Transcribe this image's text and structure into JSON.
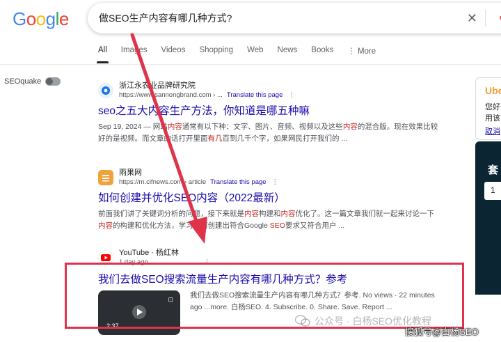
{
  "logo": {
    "letters": [
      "G",
      "o",
      "o",
      "g",
      "l",
      "e"
    ]
  },
  "search": {
    "query": "做SEO生产内容有哪几种方式?",
    "clear_icon": "close-icon",
    "mic_icon": "mic-icon"
  },
  "tabs": [
    "All",
    "Images",
    "Videos",
    "Shopping",
    "Web",
    "News",
    "Books",
    "⋮ More"
  ],
  "sidebar": {
    "seoquake_label": "SEOquake"
  },
  "results": [
    {
      "site_name": "浙江永",
      "site_name_tail": "农业品牌研究院",
      "url": "https://www.sannongbrand.com › ...",
      "translate": "Translate this page",
      "title": "seo之五大内容生产方法，你知道是哪五种嘛",
      "snippet_1_a": "Sep 19, 2024 — 网站",
      "snippet_1_hl": "内容",
      "snippet_1_b": "通常有以下种：文字、图片、音频、视频以及这些",
      "snippet_1_hl2": "内容",
      "snippet_1_c": "的混合版。现在效果比较",
      "snippet_2_a": "好的是视频。而文章的话打开里面",
      "snippet_2_hl": "有几",
      "snippet_2_b": "百到几千个字，如果网民打开我们的 ..."
    },
    {
      "site_name": "雨果网",
      "url": "https://m.cifnews.com › article",
      "translate": "Translate this page",
      "title": "如何创建并优化SEO内容（2022最新）",
      "snippet_1_a": "前面我们讲了关键词分析的问题，接下来就是",
      "snippet_1_hl": "内容",
      "snippet_1_b": "构建和",
      "snippet_1_hl2": "内容",
      "snippet_1_c": "优化了。这一篇文章我们就一起来讨论一下",
      "snippet_2_hl": "内容",
      "snippet_2_a": "的构建和优化方法，学习如何创建出符合Google ",
      "snippet_2_hl2": "SEO",
      "snippet_2_b": "要求又符合用户 ..."
    },
    {
      "site_name": "YouTube · 杨红林",
      "url": "1 day ago",
      "title": "我们去做SEO搜索流量生产内容有哪几种方式？参考",
      "snippet_1": "我们去做SEO搜索流量生产内容有哪几种方式？参考. No views · 22 minutes",
      "snippet_2": "ago ...more. 白杨SEO. 4. Subscribe. 0. Share. Save. Report ...",
      "duration": "2:37"
    }
  ],
  "ad": {
    "brand": "Ube",
    "line1": "您好",
    "line2": "用该",
    "line3": "取消",
    "big": "套",
    "input": "1"
  },
  "watermarks": {
    "wechat": "公众号 · 白杨SEO优化教程",
    "bottom": "搜狐号@白杨SEO"
  },
  "colors": {
    "link": "#1a0dab",
    "highlight": "#c5221f",
    "annotation_red": "#e0334a"
  }
}
